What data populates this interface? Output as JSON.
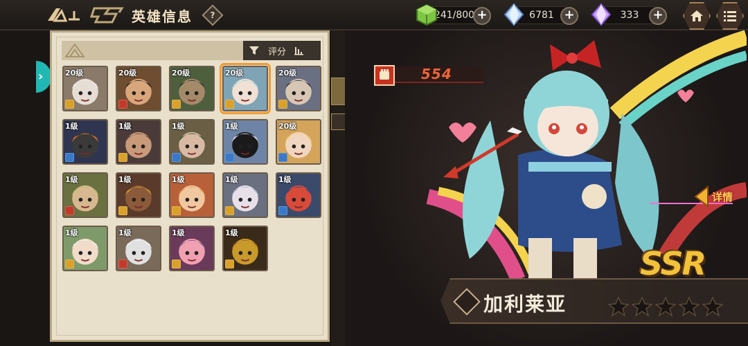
{
  "header": {
    "title": "英雄信息",
    "help_label": "?"
  },
  "resources": [
    {
      "name": "stamina",
      "value": "241/800",
      "icon": "green-cube-icon",
      "color": "#6fb33a"
    },
    {
      "name": "crystal",
      "value": "6781",
      "icon": "blue-crystal-icon",
      "color": "#9fc7ff"
    },
    {
      "name": "gem",
      "value": "333",
      "icon": "purple-crystal-icon",
      "color": "#c79cff"
    }
  ],
  "filter": {
    "sort_label": "评分"
  },
  "heroes": [
    {
      "level": "20级",
      "class_color": "#d9a12a",
      "face": "#e6ddd5",
      "hair": "#ececec",
      "bg": "#8a7a6a"
    },
    {
      "level": "20级",
      "class_color": "#c43a2a",
      "face": "#d9a67c",
      "hair": "#2a2a2a",
      "bg": "#6f4d30"
    },
    {
      "level": "20级",
      "class_color": "#d9a12a",
      "face": "#a58a6a",
      "hair": "#2a3a2a",
      "bg": "#4e5f3e"
    },
    {
      "level": "20级",
      "class_color": "#d9a12a",
      "face": "#f1e0d4",
      "hair": "#8fd5d8",
      "bg": "#7fa4b6",
      "selected": true
    },
    {
      "level": "20级",
      "class_color": "#d9a12a",
      "face": "#d8c6b4",
      "hair": "#3a3a44",
      "bg": "#6a6f82"
    },
    {
      "level": "1级",
      "class_color": "#3a79c8",
      "face": "#3a3a3a",
      "hair": "#e8702a",
      "bg": "#2f3550"
    },
    {
      "level": "1级",
      "class_color": "#d9a12a",
      "face": "#c99a7a",
      "hair": "#6a4a3a",
      "bg": "#4a3a3a"
    },
    {
      "level": "1级",
      "class_color": "#3a79c8",
      "face": "#d9b9a4",
      "hair": "#3a5a3a",
      "bg": "#6a5f45"
    },
    {
      "level": "1级",
      "class_color": "#3a79c8",
      "face": "#1a1a1a",
      "hair": "#d8d8e8",
      "bg": "#6d84a6"
    },
    {
      "level": "20级",
      "class_color": "#3a79c8",
      "face": "#f0d6c0",
      "hair": "#f1d07a",
      "bg": "#d4a45a"
    },
    {
      "level": "1级",
      "class_color": "#c43a2a",
      "face": "#d8b890",
      "hair": "#b5c26a",
      "bg": "#6a7040"
    },
    {
      "level": "1级",
      "class_color": "#d9a12a",
      "face": "#8a5a3a",
      "hair": "#d9a12a",
      "bg": "#5a3a2a"
    },
    {
      "level": "1级",
      "class_color": "#d9a12a",
      "face": "#f0c8a0",
      "hair": "#e89a4a",
      "bg": "#b8603a"
    },
    {
      "level": "1级",
      "class_color": "#d9a12a",
      "face": "#e8e0e8",
      "hair": "#a8b8c8",
      "bg": "#6a7080"
    },
    {
      "level": "1级",
      "class_color": "#3a79c8",
      "face": "#d84a3a",
      "hair": "#2a4a8a",
      "bg": "#3a4a6a"
    },
    {
      "level": "1级",
      "class_color": "#d9a12a",
      "face": "#f0dcc8",
      "hair": "#f0f0f0",
      "bg": "#7f9a6a"
    },
    {
      "level": "1级",
      "class_color": "#c43a2a",
      "face": "#e0e0e0",
      "hair": "#f6f6f6",
      "bg": "#7a6a5a"
    },
    {
      "level": "1级",
      "class_color": "#d9a12a",
      "face": "#f0a0b0",
      "hair": "#7a5a8a",
      "bg": "#6a3a5a"
    },
    {
      "level": "1级",
      "class_color": "#d9a12a",
      "face": "#c89a2a",
      "hair": "#a86a1a",
      "bg": "#3a2a1a"
    }
  ],
  "selected_hero": {
    "power": "554",
    "name": "加利莱亚",
    "rarity": "SSR",
    "stars": 5,
    "detail_label": "详情"
  }
}
